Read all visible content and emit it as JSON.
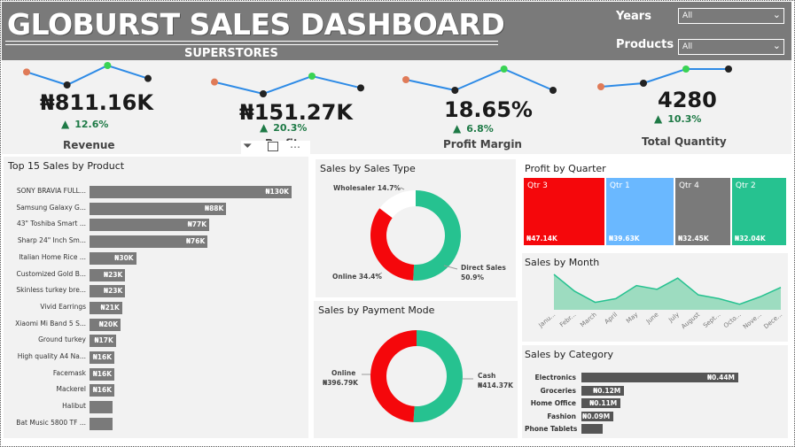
{
  "header": {
    "title": "GLOBURST SALES DASHBOARD",
    "subtitle": "SUPERSTORES",
    "filters": [
      {
        "label": "Years",
        "value": "All"
      },
      {
        "label": "Products",
        "value": "All"
      }
    ]
  },
  "kpis": [
    {
      "value": "₦811.16K",
      "delta": "12.6%",
      "label": "Revenue",
      "trend": [
        3,
        1,
        4,
        2
      ]
    },
    {
      "value": "₦151.27K",
      "delta": "20.3%",
      "label": "Profit",
      "trend": [
        2,
        0,
        3,
        1
      ]
    },
    {
      "value": "18.65%",
      "delta": "6.8%",
      "label": "Profit Margin",
      "trend": [
        3,
        1,
        5,
        1
      ]
    },
    {
      "value": "4280",
      "delta": "10.3%",
      "label": "Total Quantity",
      "trend": [
        1,
        2,
        6,
        6
      ]
    }
  ],
  "colors": {
    "delta_up": "#1e7a46",
    "trend_line": "#2e8be6",
    "trend_start": "#e07b58",
    "trend_peak": "#39d353",
    "trend_end": "#222222"
  },
  "top_products": {
    "title": "Top 15 Sales by Product",
    "items": [
      {
        "label": "SONY BRAVIA FULL...",
        "value": 130,
        "display": "₦130K"
      },
      {
        "label": "Samsung Galaxy G...",
        "value": 88,
        "display": "₦88K"
      },
      {
        "label": "43\" Toshiba Smart ...",
        "value": 77,
        "display": "₦77K"
      },
      {
        "label": "Sharp 24\" Inch Sm...",
        "value": 76,
        "display": "₦76K"
      },
      {
        "label": "Italian Home Rice ...",
        "value": 30,
        "display": "₦30K"
      },
      {
        "label": "Customized Gold B...",
        "value": 23,
        "display": "₦23K"
      },
      {
        "label": "Skinless turkey bre...",
        "value": 23,
        "display": "₦23K"
      },
      {
        "label": "Vivid Earrings",
        "value": 21,
        "display": "₦21K"
      },
      {
        "label": "Xiaomi Mi Band 5 S...",
        "value": 20,
        "display": "₦20K"
      },
      {
        "label": "Ground turkey",
        "value": 17,
        "display": "₦17K"
      },
      {
        "label": "High quality A4 Na...",
        "value": 16,
        "display": "₦16K"
      },
      {
        "label": "Facemask",
        "value": 16,
        "display": "₦16K"
      },
      {
        "label": "Mackerel",
        "value": 16,
        "display": "₦16K"
      },
      {
        "label": "Halibut",
        "value": 15,
        "display": ""
      },
      {
        "label": "Bat Music 5800 TF ...",
        "value": 15,
        "display": ""
      }
    ]
  },
  "sales_type": {
    "title": "Sales by Sales Type",
    "slices": [
      {
        "name": "Direct Sales",
        "pct": 50.9,
        "color": "#26c290",
        "label": "Direct Sales",
        "pct_label": "50.9%"
      },
      {
        "name": "Online",
        "pct": 34.4,
        "color": "#f5070b",
        "label": "Online 34.4%"
      },
      {
        "name": "Wholesaler",
        "pct": 14.7,
        "color": "#ffffff",
        "label": "Wholesaler 14.7%"
      }
    ]
  },
  "payment_mode": {
    "title": "Sales by Payment Mode",
    "slices": [
      {
        "name": "Cash",
        "value": 414.37,
        "color": "#26c290",
        "label": "Cash",
        "value_label": "₦414.37K"
      },
      {
        "name": "Online",
        "value": 396.79,
        "color": "#f5070b",
        "label": "Online",
        "value_label": "₦396.79K"
      }
    ]
  },
  "profit_quarter": {
    "title": "Profit by Quarter",
    "tiles": [
      {
        "name": "Qtr 3",
        "value": 47.14,
        "display": "₦47.14K",
        "color": "#f5070b"
      },
      {
        "name": "Qtr 1",
        "value": 39.63,
        "display": "₦39.63K",
        "color": "#6ab8ff"
      },
      {
        "name": "Qtr 4",
        "value": 32.45,
        "display": "₦32.45K",
        "color": "#7a7a7a"
      },
      {
        "name": "Qtr 2",
        "value": 32.04,
        "display": "₦32.04K",
        "color": "#26c290"
      }
    ]
  },
  "sales_month": {
    "title": "Sales by Month",
    "months": [
      "Janu...",
      "Febr...",
      "March",
      "April",
      "May",
      "June",
      "July",
      "August",
      "Sept...",
      "Octo...",
      "Nove...",
      "Dece..."
    ],
    "values": [
      95,
      50,
      20,
      30,
      65,
      55,
      85,
      40,
      30,
      15,
      35,
      60
    ],
    "color": "#9ddcc0",
    "line_color": "#26c290"
  },
  "category": {
    "title": "Sales by Category",
    "items": [
      {
        "label": "Electronics",
        "value": 0.44,
        "display": "₦0.44M"
      },
      {
        "label": "Groceries",
        "value": 0.12,
        "display": "₦0.12M"
      },
      {
        "label": "Home Office",
        "value": 0.11,
        "display": "₦0.11M"
      },
      {
        "label": "Fashion",
        "value": 0.09,
        "display": "₦0.09M"
      },
      {
        "label": "Phone Tablets",
        "value": 0.05,
        "display": ""
      }
    ]
  }
}
